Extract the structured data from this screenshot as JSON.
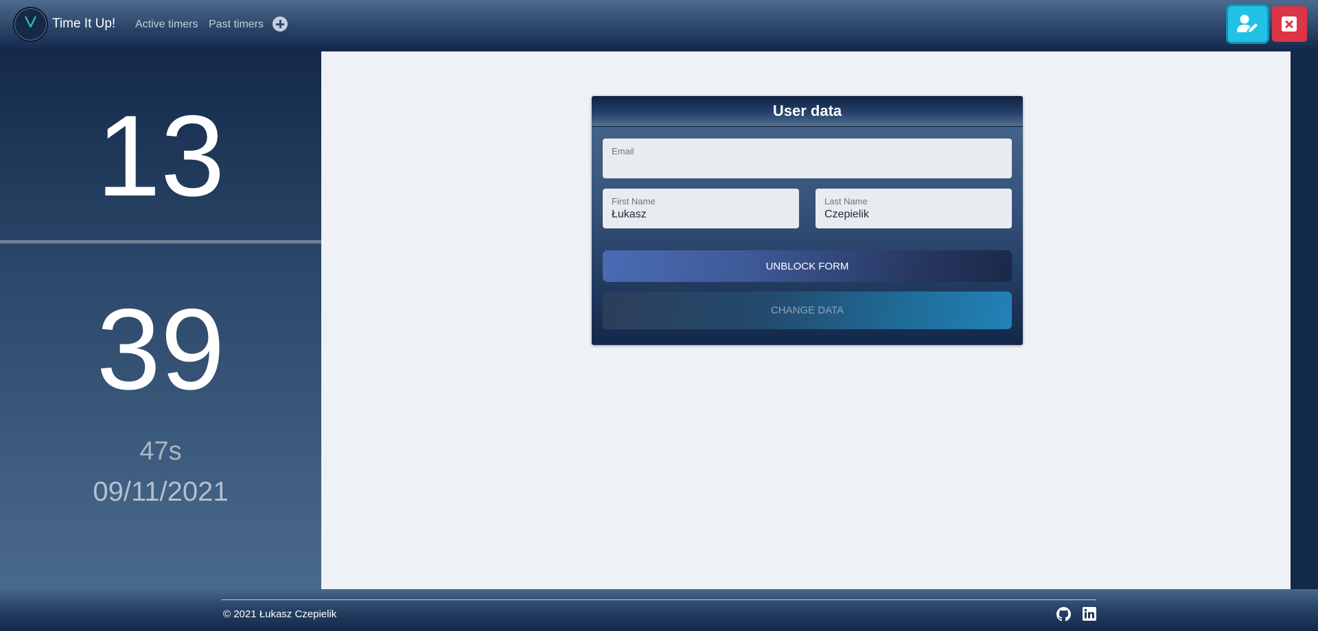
{
  "navbar": {
    "brand": "Time It Up!",
    "links": [
      {
        "label": "Active timers"
      },
      {
        "label": "Past timers"
      }
    ],
    "add_icon": "plus-circle-icon",
    "user_edit_icon": "user-edit-icon",
    "close_icon": "close-box-icon",
    "colors": {
      "user_button": "#22c1e8",
      "close_button": "#dc3545"
    }
  },
  "timer": {
    "hours": "13",
    "minutes": "39",
    "seconds": "47s",
    "date": "09/11/2021"
  },
  "user_form": {
    "title": "User data",
    "email": {
      "label": "Email",
      "value": ""
    },
    "first_name": {
      "label": "First Name",
      "value": "Łukasz"
    },
    "last_name": {
      "label": "Last Name",
      "value": "Czepielik"
    },
    "unblock_label": "UNBLOCK FORM",
    "change_label": "CHANGE DATA"
  },
  "footer": {
    "copyright": "© 2021 Łukasz Czepielik",
    "icons": [
      "github-icon",
      "linkedin-icon"
    ]
  }
}
